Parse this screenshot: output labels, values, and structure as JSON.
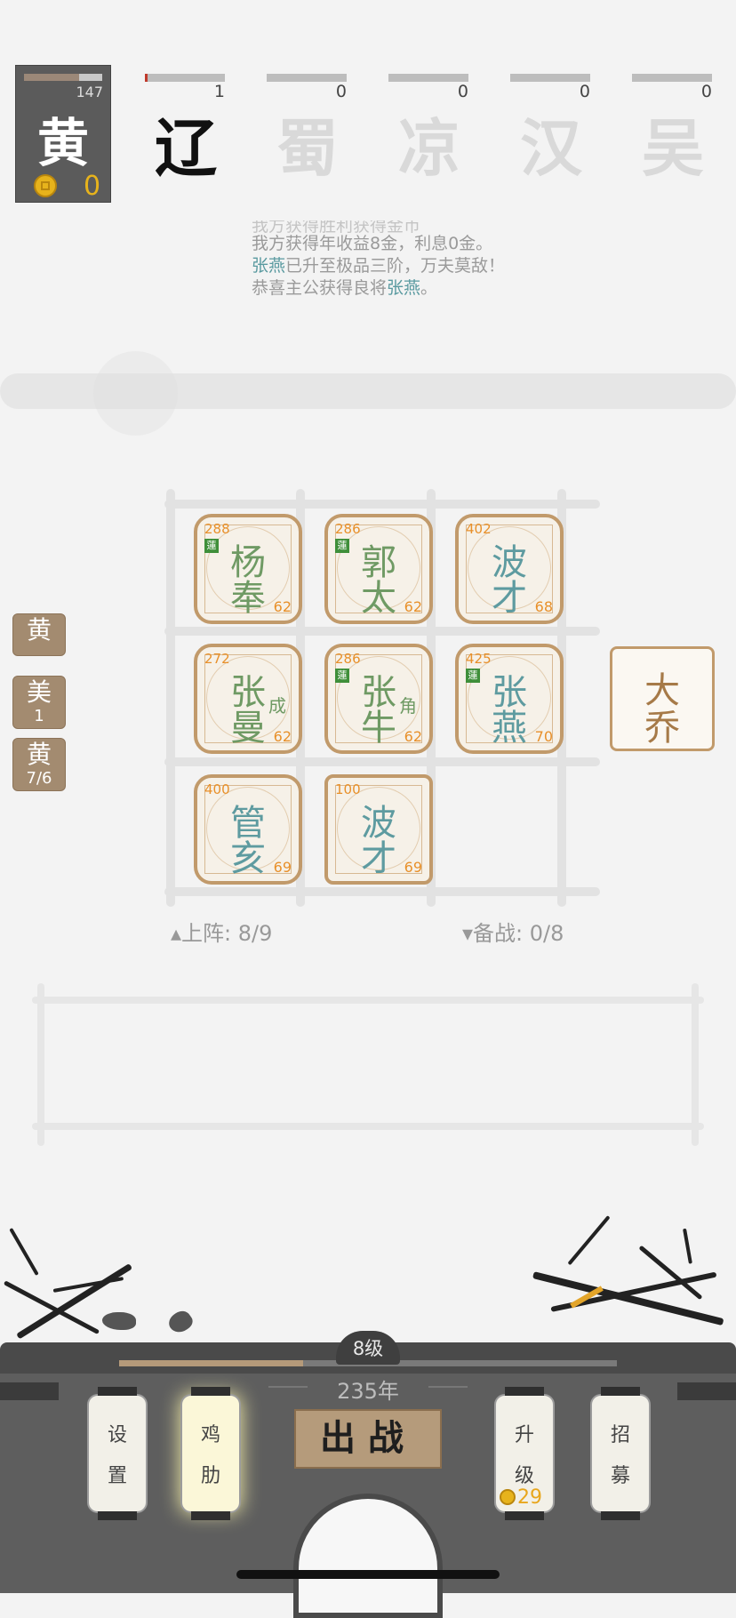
{
  "player": {
    "name": "黄",
    "hp_value": "147",
    "hp_fraction": 0.7,
    "gold": "0"
  },
  "factions": [
    {
      "name": "辽",
      "count": "1",
      "active": true
    },
    {
      "name": "蜀",
      "count": "0",
      "active": false
    },
    {
      "name": "凉",
      "count": "0",
      "active": false
    },
    {
      "name": "汉",
      "count": "0",
      "active": false
    },
    {
      "name": "吴",
      "count": "0",
      "active": false
    }
  ],
  "log": {
    "line0": "我方获得胜利获得金币",
    "line1": "我方获得年收益8金，利息0金。",
    "line2_name": "张燕",
    "line2_rest": "已升至极品三阶，万夫莫敌！",
    "line3_pre": "恭喜主公获得良将",
    "line3_name": "张燕",
    "line3_end": "。"
  },
  "side_chips": [
    {
      "c1": "黄",
      "c2": ""
    },
    {
      "c1": "美",
      "c2": "1"
    },
    {
      "c1": "黄",
      "c2": "7/6"
    }
  ],
  "board": [
    {
      "n1": "杨",
      "n2": "奉",
      "top": "288",
      "bot": "62",
      "badge": "蓮",
      "side": "",
      "color": "green"
    },
    {
      "n1": "郭",
      "n2": "太",
      "top": "286",
      "bot": "62",
      "badge": "蓮",
      "side": "",
      "color": "green"
    },
    {
      "n1": "波",
      "n2": "才",
      "top": "402",
      "bot": "68",
      "badge": "",
      "side": "",
      "color": "teal"
    },
    {
      "n1": "张",
      "n2": "曼",
      "top": "272",
      "bot": "62",
      "badge": "",
      "side": "成",
      "color": "green"
    },
    {
      "n1": "张",
      "n2": "牛",
      "top": "286",
      "bot": "62",
      "badge": "蓮",
      "side": "角",
      "color": "green"
    },
    {
      "n1": "张",
      "n2": "燕",
      "top": "425",
      "bot": "70",
      "badge": "蓮",
      "side": "",
      "color": "teal"
    },
    {
      "n1": "管",
      "n2": "亥",
      "top": "400",
      "bot": "69",
      "badge": "",
      "side": "",
      "color": "teal"
    },
    {
      "n1": "波",
      "n2": "才",
      "top": "100",
      "bot": "69",
      "badge": "",
      "side": "",
      "color": "teal"
    }
  ],
  "bench": {
    "n1": "大",
    "n2": "乔"
  },
  "stats": {
    "deployed": "▴上阵: 8/9",
    "reserve": "▾备战: 0/8"
  },
  "bottom": {
    "level": "8级",
    "xp_fraction": 0.37,
    "year": "235年",
    "fight": "出战",
    "lanterns": [
      {
        "t1": "设",
        "t2": "置",
        "cost": ""
      },
      {
        "t1": "鸡",
        "t2": "肋",
        "cost": ""
      },
      {
        "t1": "升",
        "t2": "级",
        "cost": "29"
      },
      {
        "t1": "招",
        "t2": "募",
        "cost": ""
      }
    ]
  },
  "colors": {
    "tile_border": "#c19a6b",
    "green_name": "#6f9a64",
    "teal_name": "#5e9ba0",
    "number": "#e8902a"
  }
}
